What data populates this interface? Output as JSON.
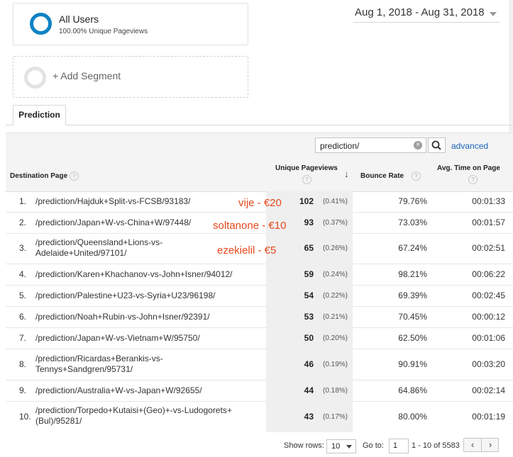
{
  "segments": {
    "all_users": {
      "title": "All Users",
      "subtitle": "100.00% Unique Pageviews"
    },
    "add_segment": {
      "label": "+ Add Segment"
    }
  },
  "date_range": "Aug 1, 2018 - Aug 31, 2018",
  "tab": {
    "label": "Prediction"
  },
  "filter": {
    "value": "prediction/",
    "clear_glyph": "×",
    "advanced_label": "advanced"
  },
  "columns": {
    "destination": "Destination Page",
    "unique_pageviews": "Unique Pageviews",
    "bounce_rate": "Bounce Rate",
    "avg_time_line1": "Avg. Time on Page",
    "help_glyph": "?",
    "sort_glyph": "↓"
  },
  "rows": [
    {
      "idx": "1.",
      "page": "/prediction/Hajduk+Split-vs-FCSB/93183/",
      "pv": "102",
      "pct": "(0.41%)",
      "bounce": "79.76%",
      "time": "00:01:33"
    },
    {
      "idx": "2.",
      "page": "/prediction/Japan+W-vs-China+W/97448/",
      "pv": "93",
      "pct": "(0.37%)",
      "bounce": "73.03%",
      "time": "00:01:57"
    },
    {
      "idx": "3.",
      "page": "/prediction/Queensland+Lions-vs-Adelaide+United/97101/",
      "pv": "65",
      "pct": "(0.26%)",
      "bounce": "67.24%",
      "time": "00:02:51"
    },
    {
      "idx": "4.",
      "page": "/prediction/Karen+Khachanov-vs-John+Isner/94012/",
      "pv": "59",
      "pct": "(0.24%)",
      "bounce": "98.21%",
      "time": "00:06:22"
    },
    {
      "idx": "5.",
      "page": "/prediction/Palestine+U23-vs-Syria+U23/96198/",
      "pv": "54",
      "pct": "(0.22%)",
      "bounce": "69.39%",
      "time": "00:02:45"
    },
    {
      "idx": "6.",
      "page": "/prediction/Noah+Rubin-vs-John+Isner/92391/",
      "pv": "53",
      "pct": "(0.21%)",
      "bounce": "70.45%",
      "time": "00:00:12"
    },
    {
      "idx": "7.",
      "page": "/prediction/Japan+W-vs-Vietnam+W/95750/",
      "pv": "50",
      "pct": "(0.20%)",
      "bounce": "62.50%",
      "time": "00:01:06"
    },
    {
      "idx": "8.",
      "page": "/prediction/Ricardas+Berankis-vs-Tennys+Sandgren/95731/",
      "pv": "46",
      "pct": "(0.19%)",
      "bounce": "90.91%",
      "time": "00:03:20"
    },
    {
      "idx": "9.",
      "page": "/prediction/Australia+W-vs-Japan+W/92655/",
      "pv": "44",
      "pct": "(0.18%)",
      "bounce": "64.86%",
      "time": "00:02:14"
    },
    {
      "idx": "10.",
      "page": "/prediction/Torpedo+Kutaisi+(Geo)+-vs-Ludogorets+(Bul)/95281/",
      "pv": "43",
      "pct": "(0.17%)",
      "bounce": "80.00%",
      "time": "00:01:19"
    }
  ],
  "annotations": [
    "vije - €20",
    "soltanone - €10",
    "ezekielil - €5"
  ],
  "footer": {
    "show_rows_label": "Show rows:",
    "show_rows_value": "10",
    "goto_label": "Go to:",
    "goto_value": "1",
    "range_text": "1 - 10 of 5583",
    "prev_glyph": "‹",
    "next_glyph": "›"
  },
  "colors": {
    "accent": "#0f82c5",
    "annotation": "#e8481c",
    "link": "#1a64b8"
  }
}
